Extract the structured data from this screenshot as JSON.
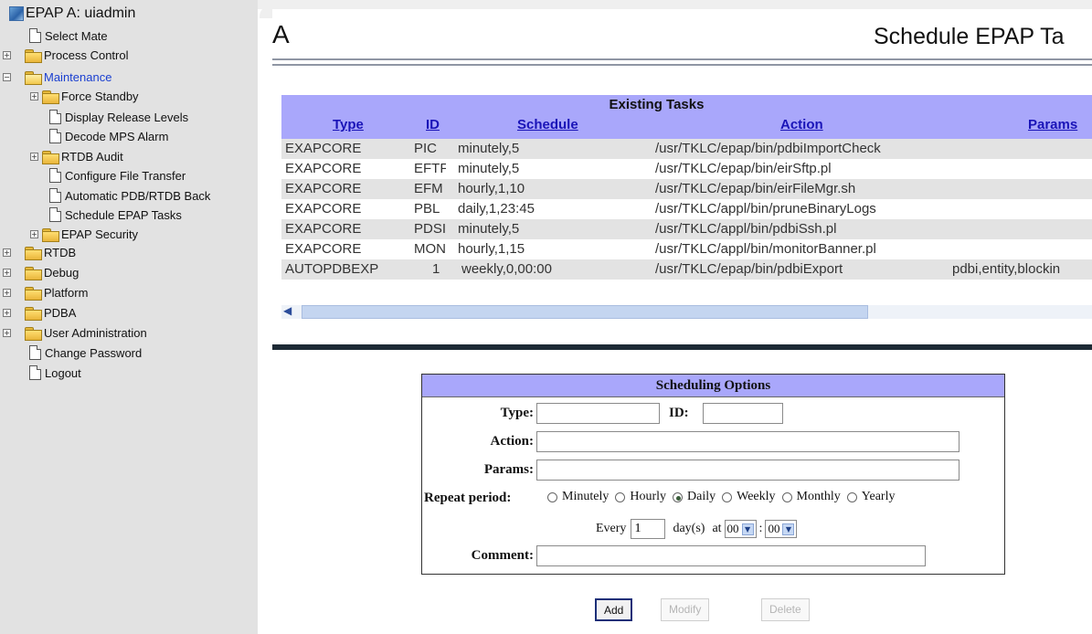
{
  "sidebar": {
    "root_label": "EPAP A: uiadmin",
    "items": [
      {
        "label": "Select Mate"
      },
      {
        "label": "Process Control"
      },
      {
        "label": "Maintenance"
      },
      {
        "label": "Force Standby"
      },
      {
        "label": "Display Release Levels"
      },
      {
        "label": "Decode MPS Alarm"
      },
      {
        "label": "RTDB Audit"
      },
      {
        "label": "Configure File Transfer"
      },
      {
        "label": "Automatic PDB/RTDB Back"
      },
      {
        "label": "Schedule EPAP Tasks"
      },
      {
        "label": "EPAP Security"
      },
      {
        "label": "RTDB"
      },
      {
        "label": "Debug"
      },
      {
        "label": "Platform"
      },
      {
        "label": "PDBA"
      },
      {
        "label": "User Administration"
      },
      {
        "label": "Change Password"
      },
      {
        "label": "Logout"
      }
    ]
  },
  "page": {
    "code": "A",
    "title": "Schedule EPAP Ta"
  },
  "tasks": {
    "title": "Existing Tasks",
    "columns": [
      "Type",
      "ID",
      "Schedule",
      "Action",
      "Params"
    ],
    "rows": [
      {
        "type": "EXAPCORE",
        "id": "PIC",
        "schedule": "minutely,5",
        "action": "/usr/TKLC/epap/bin/pdbiImportCheck",
        "params": ""
      },
      {
        "type": "EXAPCORE",
        "id": "EFTF",
        "schedule": "minutely,5",
        "action": "/usr/TKLC/epap/bin/eirSftp.pl",
        "params": ""
      },
      {
        "type": "EXAPCORE",
        "id": "EFM",
        "schedule": "hourly,1,10",
        "action": "/usr/TKLC/epap/bin/eirFileMgr.sh",
        "params": ""
      },
      {
        "type": "EXAPCORE",
        "id": "PBL",
        "schedule": "daily,1,23:45",
        "action": "/usr/TKLC/appl/bin/pruneBinaryLogs",
        "params": ""
      },
      {
        "type": "EXAPCORE",
        "id": "PDSI",
        "schedule": "minutely,5",
        "action": "/usr/TKLC/appl/bin/pdbiSsh.pl",
        "params": ""
      },
      {
        "type": "EXAPCORE",
        "id": "MONI",
        "schedule": "hourly,1,15",
        "action": "/usr/TKLC/appl/bin/monitorBanner.pl",
        "params": ""
      },
      {
        "type": "AUTOPDBEXP",
        "id": "1",
        "schedule": "weekly,0,00:00",
        "action": "/usr/TKLC/epap/bin/pdbiExport",
        "params": "pdbi,entity,blockin"
      }
    ]
  },
  "form": {
    "title": "Scheduling Options",
    "type_label": "Type:",
    "type_value": "",
    "id_label": "ID:",
    "id_value": "",
    "action_label": "Action:",
    "action_value": "",
    "params_label": "Params:",
    "params_value": "",
    "repeat_label": "Repeat period:",
    "repeat_options": [
      "Minutely",
      "Hourly",
      "Daily",
      "Weekly",
      "Monthly",
      "Yearly"
    ],
    "repeat_selected": "Daily",
    "every_label": "Every",
    "every_value": "1",
    "every_unit": "day(s)",
    "at_label": "at",
    "hour_value": "00",
    "minute_value": "00",
    "time_sep": ":",
    "comment_label": "Comment:",
    "comment_value": ""
  },
  "buttons": {
    "add": "Add",
    "modify": "Modify",
    "delete": "Delete"
  }
}
